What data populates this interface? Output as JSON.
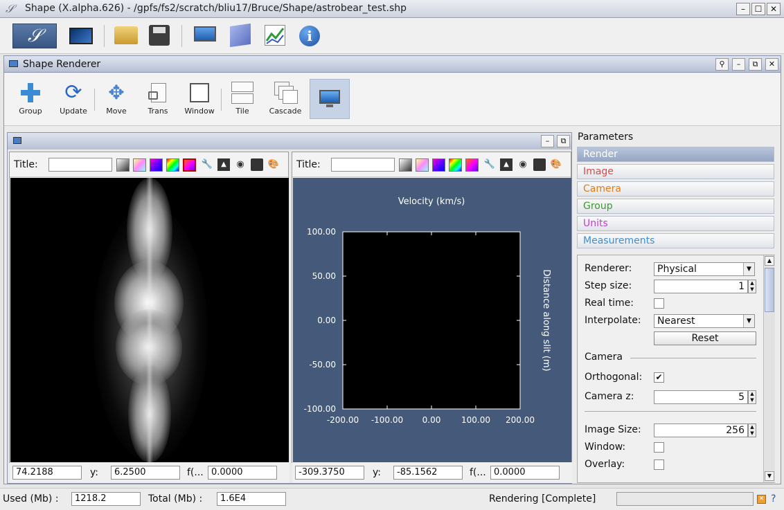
{
  "window": {
    "title": "Shape (X.alpha.626) - /gpfs/fs2/scratch/bliu17/Bruce/Shape/astrobear_test.shp"
  },
  "renderer_panel": {
    "title": "Shape Renderer"
  },
  "tools": [
    {
      "label": "Group"
    },
    {
      "label": "Update"
    },
    {
      "label": "Move"
    },
    {
      "label": "Trans"
    },
    {
      "label": "Window"
    },
    {
      "label": "Tile"
    },
    {
      "label": "Cascade"
    }
  ],
  "views": {
    "left": {
      "title_label": "Title:",
      "title_value": "",
      "x": "74.2188",
      "y_label": "y:",
      "y": "6.2500",
      "f_label": "f(...",
      "f": "0.0000"
    },
    "right": {
      "title_label": "Title:",
      "title_value": "",
      "x": "-309.3750",
      "y_label": "y:",
      "y": "-85.1562",
      "f_label": "f(...",
      "f": "0.0000"
    }
  },
  "chart_data": {
    "type": "scatter",
    "title": "Velocity (km/s)",
    "xlabel": "",
    "ylabel": "Distance along slit (m)",
    "xlim": [
      -200,
      200
    ],
    "ylim": [
      -100,
      100
    ],
    "xticks": [
      "-200.00",
      "-100.00",
      "0.00",
      "100.00",
      "200.00"
    ],
    "yticks": [
      "100.00",
      "50.00",
      "0.00",
      "-50.00",
      "-100.00"
    ],
    "series": [],
    "background": "#45597a",
    "plot_area_color": "#000000"
  },
  "params": {
    "header": "Parameters",
    "sections": [
      {
        "label": "Render",
        "color": "#ffffff"
      },
      {
        "label": "Image",
        "color": "#d94a4a"
      },
      {
        "label": "Camera",
        "color": "#e07a1c"
      },
      {
        "label": "Group",
        "color": "#3a9a2e"
      },
      {
        "label": "Units",
        "color": "#c040c8"
      },
      {
        "label": "Measurements",
        "color": "#3d8fd0"
      }
    ],
    "renderer_label": "Renderer:",
    "renderer_value": "Physical",
    "step_label": "Step size:",
    "step_value": "1",
    "realtime_label": "Real time:",
    "interp_label": "Interpolate:",
    "interp_value": "Nearest",
    "reset_label": "Reset",
    "camera_group": "Camera",
    "ortho_label": "Orthogonal:",
    "camz_label": "Camera z:",
    "camz_value": "5",
    "imgsize_label": "Image Size:",
    "imgsize_value": "256",
    "window_label": "Window:",
    "overlay_label": "Overlay:"
  },
  "status": {
    "used_label": "Used (Mb) :",
    "used_value": "1218.2",
    "total_label": "Total (Mb) :",
    "total_value": "1.6E4",
    "render_status": "Rendering [Complete]"
  }
}
